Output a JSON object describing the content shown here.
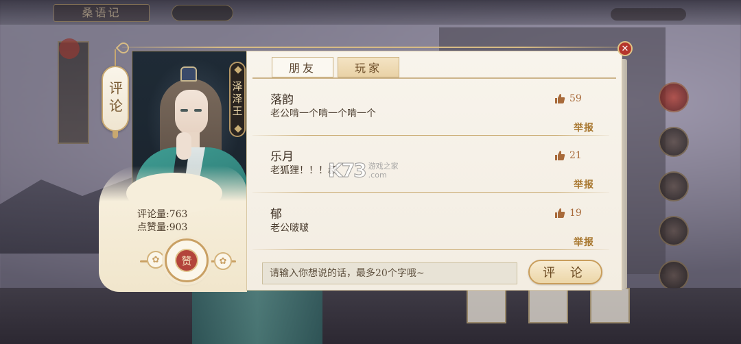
{
  "panel": {
    "vertical_tag": "评论",
    "character_name": "泽泽王",
    "stats": {
      "comments_label": "评论量:",
      "comments_value": "763",
      "likes_label": "点赞量:",
      "likes_value": "903"
    },
    "like_button_label": "赞"
  },
  "tabs": [
    {
      "label": "朋友",
      "active": false
    },
    {
      "label": "玩家",
      "active": true
    }
  ],
  "comments": [
    {
      "name": "落韵",
      "text": "老公啃一个啃一个啃一个",
      "likes": "59",
      "report": "举报"
    },
    {
      "name": "乐月",
      "text": "老狐狸！！！叔",
      "likes": "21",
      "report": "举报"
    },
    {
      "name": "郁",
      "text": "老公啵啵",
      "likes": "19",
      "report": "举报"
    }
  ],
  "input": {
    "placeholder": "请输入你想说的话，最多20个字哦~"
  },
  "submit_label": "评 论",
  "background": {
    "title": "桑语记"
  },
  "watermark": {
    "logo": "K73",
    "line1": "游戏之家",
    "line2": ".com"
  },
  "colors": {
    "accent_gold": "#c9a064",
    "like_red": "#b3443b",
    "close_red": "#b5362c"
  },
  "icons": [
    "thumbs-up-icon",
    "close-icon"
  ]
}
